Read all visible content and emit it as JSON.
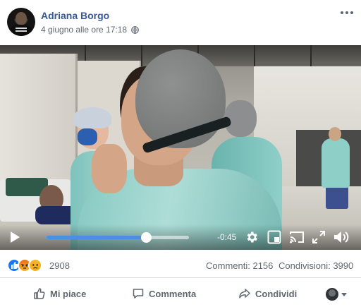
{
  "post": {
    "author": "Adriana Borgo",
    "timestamp": "4 giugno alle ore 17:18",
    "privacy_icon": "globe-icon",
    "more_icon": "more-options-icon"
  },
  "video": {
    "time_remaining": "-0:45",
    "progress": 0.7,
    "accent_color": "#4a90e2",
    "controls": [
      "play-icon",
      "gear-icon",
      "quality-icon",
      "cast-icon",
      "fullscreen-icon",
      "volume-icon"
    ]
  },
  "stats": {
    "reaction_icons": [
      "like-reaction-icon",
      "angry-reaction-icon",
      "sad-reaction-icon"
    ],
    "reaction_count": "2908",
    "comments": "Commenti: 2156",
    "shares": "Condivisioni: 3990"
  },
  "actions": {
    "like": "Mi piace",
    "comment": "Commenta",
    "share": "Condividi"
  },
  "colors": {
    "author_link": "#385898",
    "facebook_blue": "#1877f2"
  }
}
